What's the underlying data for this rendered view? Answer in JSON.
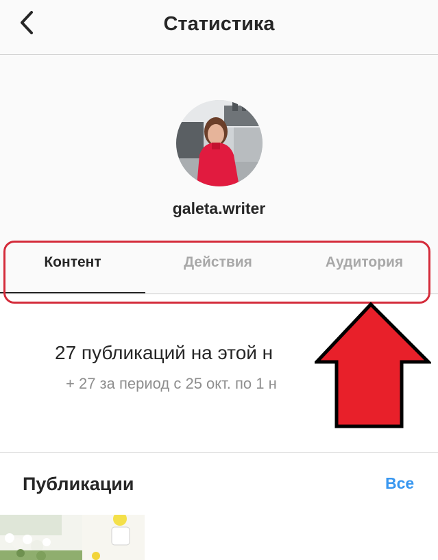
{
  "header": {
    "title": "Статистика",
    "back_icon": "chevron-left-icon"
  },
  "profile": {
    "username": "galeta.writer"
  },
  "tabs": [
    {
      "label": "Контент",
      "active": true
    },
    {
      "label": "Действия",
      "active": false
    },
    {
      "label": "Аудитория",
      "active": false
    }
  ],
  "summary": {
    "main": "27 публикаций на этой н",
    "sub": "+ 27 за период с 25 окт. по 1 н"
  },
  "posts": {
    "title": "Публикации",
    "all_label": "Все"
  },
  "colors": {
    "accent_link": "#3897f0",
    "annotation_red": "#e8202a",
    "highlight_border": "#d42b3a"
  }
}
